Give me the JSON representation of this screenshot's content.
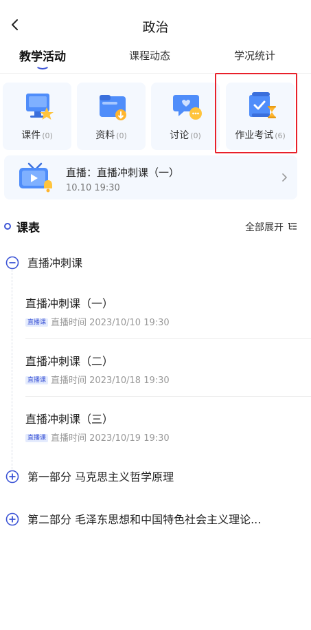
{
  "header": {
    "title": "政治",
    "back_icon": "chevron-left-icon"
  },
  "tabs": [
    {
      "label": "教学活动",
      "active": true
    },
    {
      "label": "课程动态",
      "active": false
    },
    {
      "label": "学况统计",
      "active": false
    }
  ],
  "colors": {
    "accent": "#3d55d6",
    "highlight_border": "#e8202a",
    "card_bg": "#f4f8fe"
  },
  "tools": [
    {
      "label": "课件",
      "count": "(0)",
      "icon": "courseware-icon"
    },
    {
      "label": "资料",
      "count": "(0)",
      "icon": "materials-folder-icon"
    },
    {
      "label": "讨论",
      "count": "(0)",
      "icon": "discussion-chat-icon"
    },
    {
      "label": "作业考试",
      "count": "(6)",
      "icon": "homework-exam-icon"
    }
  ],
  "live": {
    "title": "直播：直播冲刺课（一）",
    "time": "10.10 19:30",
    "icon": "live-tv-icon"
  },
  "schedule": {
    "title": "课表",
    "expand_label": "全部展开",
    "sections": [
      {
        "title": "直播冲刺课",
        "expanded": true,
        "lessons": [
          {
            "title": "直播冲刺课（一）",
            "badge": "直播课",
            "meta": "直播时间 2023/10/10 19:30"
          },
          {
            "title": "直播冲刺课（二）",
            "badge": "直播课",
            "meta": "直播时间 2023/10/18 19:30"
          },
          {
            "title": "直播冲刺课（三）",
            "badge": "直播课",
            "meta": "直播时间 2023/10/19 19:30"
          }
        ]
      },
      {
        "title": "第一部分 马克思主义哲学原理",
        "expanded": false
      },
      {
        "title": "第二部分 毛泽东思想和中国特色社会主义理论...",
        "expanded": false
      }
    ]
  }
}
